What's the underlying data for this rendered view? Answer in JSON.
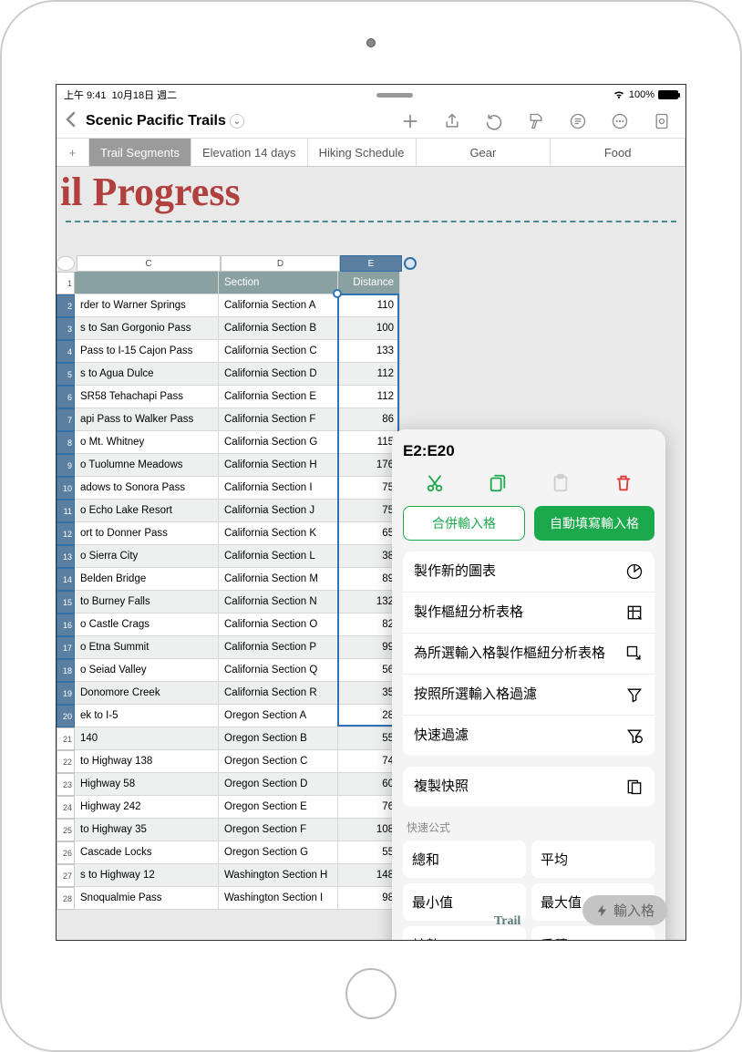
{
  "status": {
    "time": "上午 9:41",
    "date": "10月18日 週二",
    "battery": "100%"
  },
  "doc_title": "Scenic Pacific Trails",
  "tabs": {
    "items": [
      {
        "label": "Trail Segments",
        "active": true
      },
      {
        "label": "Elevation 14 days",
        "active": false
      },
      {
        "label": "Hiking Schedule",
        "active": false
      },
      {
        "label": "Gear",
        "active": false
      },
      {
        "label": "Food",
        "active": false
      }
    ]
  },
  "sheet": {
    "big_title_fragment": "il Progress",
    "columns": {
      "c": "C",
      "d": "D",
      "e": "E"
    },
    "header": {
      "section": "Section",
      "distance": "Distance"
    },
    "rows": [
      {
        "n": 1,
        "trail": "",
        "section": "Section",
        "distance": "Distance",
        "hdr": true
      },
      {
        "n": 2,
        "trail": "rder to Warner Springs",
        "section": "California Section A",
        "distance": 110,
        "sel": true
      },
      {
        "n": 3,
        "trail": "s to San Gorgonio Pass",
        "section": "California Section B",
        "distance": 100,
        "sel": true
      },
      {
        "n": 4,
        "trail": "Pass to I-15 Cajon Pass",
        "section": "California Section C",
        "distance": 133,
        "sel": true
      },
      {
        "n": 5,
        "trail": "s to Agua Dulce",
        "section": "California Section D",
        "distance": 112,
        "sel": true
      },
      {
        "n": 6,
        "trail": "SR58 Tehachapi Pass",
        "section": "California Section E",
        "distance": 112,
        "sel": true
      },
      {
        "n": 7,
        "trail": "api Pass to Walker Pass",
        "section": "California Section F",
        "distance": 86,
        "sel": true
      },
      {
        "n": 8,
        "trail": "o Mt. Whitney",
        "section": "California Section G",
        "distance": 115,
        "sel": true
      },
      {
        "n": 9,
        "trail": "o Tuolumne Meadows",
        "section": "California Section H",
        "distance": 176,
        "sel": true
      },
      {
        "n": 10,
        "trail": "adows to Sonora Pass",
        "section": "California Section I",
        "distance": 75,
        "sel": true
      },
      {
        "n": 11,
        "trail": "o Echo Lake Resort",
        "section": "California Section J",
        "distance": 75,
        "sel": true
      },
      {
        "n": 12,
        "trail": "ort to Donner Pass",
        "section": "California Section K",
        "distance": 65,
        "sel": true
      },
      {
        "n": 13,
        "trail": "o Sierra City",
        "section": "California Section L",
        "distance": 38,
        "sel": true
      },
      {
        "n": 14,
        "trail": "Belden Bridge",
        "section": "California Section M",
        "distance": 89,
        "sel": true
      },
      {
        "n": 15,
        "trail": "to Burney Falls",
        "section": "California Section N",
        "distance": 132,
        "sel": true
      },
      {
        "n": 16,
        "trail": "o Castle Crags",
        "section": "California Section O",
        "distance": 82,
        "sel": true
      },
      {
        "n": 17,
        "trail": "o Etna Summit",
        "section": "California Section P",
        "distance": 99,
        "sel": true
      },
      {
        "n": 18,
        "trail": "o Seiad Valley",
        "section": "California Section Q",
        "distance": 56,
        "sel": true
      },
      {
        "n": 19,
        "trail": "Donomore Creek",
        "section": "California Section R",
        "distance": 35,
        "sel": true
      },
      {
        "n": 20,
        "trail": "ek to I-5",
        "section": "Oregon Section A",
        "distance": 28,
        "sel": true
      },
      {
        "n": 21,
        "trail": "140",
        "section": "Oregon Section B",
        "distance": 55
      },
      {
        "n": 22,
        "trail": "to Highway 138",
        "section": "Oregon Section C",
        "distance": 74
      },
      {
        "n": 23,
        "trail": "Highway 58",
        "section": "Oregon Section D",
        "distance": 60
      },
      {
        "n": 24,
        "trail": "Highway 242",
        "section": "Oregon Section E",
        "distance": 76
      },
      {
        "n": 25,
        "trail": "to Highway 35",
        "section": "Oregon Section F",
        "distance": 108
      },
      {
        "n": 26,
        "trail": "Cascade Locks",
        "section": "Oregon Section G",
        "distance": 55
      },
      {
        "n": 27,
        "trail": "s to Highway 12",
        "section": "Washington Section H",
        "distance": 148
      },
      {
        "n": 28,
        "trail": "Snoqualmie Pass",
        "section": "Washington Section I",
        "distance": 98
      }
    ]
  },
  "popup": {
    "range": "E2:E20",
    "merge": "合併輸入格",
    "autofill": "自動填寫輸入格",
    "menu1": [
      {
        "label": "製作新的圖表",
        "icon": "pie"
      },
      {
        "label": "製作樞紐分析表格",
        "icon": "pivot"
      },
      {
        "label": "為所選輸入格製作樞紐分析表格",
        "icon": "pivot-sel"
      },
      {
        "label": "按照所選輸入格過濾",
        "icon": "funnel"
      },
      {
        "label": "快速過濾",
        "icon": "funnel-q"
      }
    ],
    "menu2": [
      {
        "label": "複製快照",
        "icon": "snapshot"
      }
    ],
    "quick_formula_title": "快速公式",
    "quick_formula": [
      "總和",
      "平均",
      "最小值",
      "最大值",
      "計數",
      "乘積"
    ]
  },
  "float_button": "輸入格",
  "bottom_label": "Trail"
}
